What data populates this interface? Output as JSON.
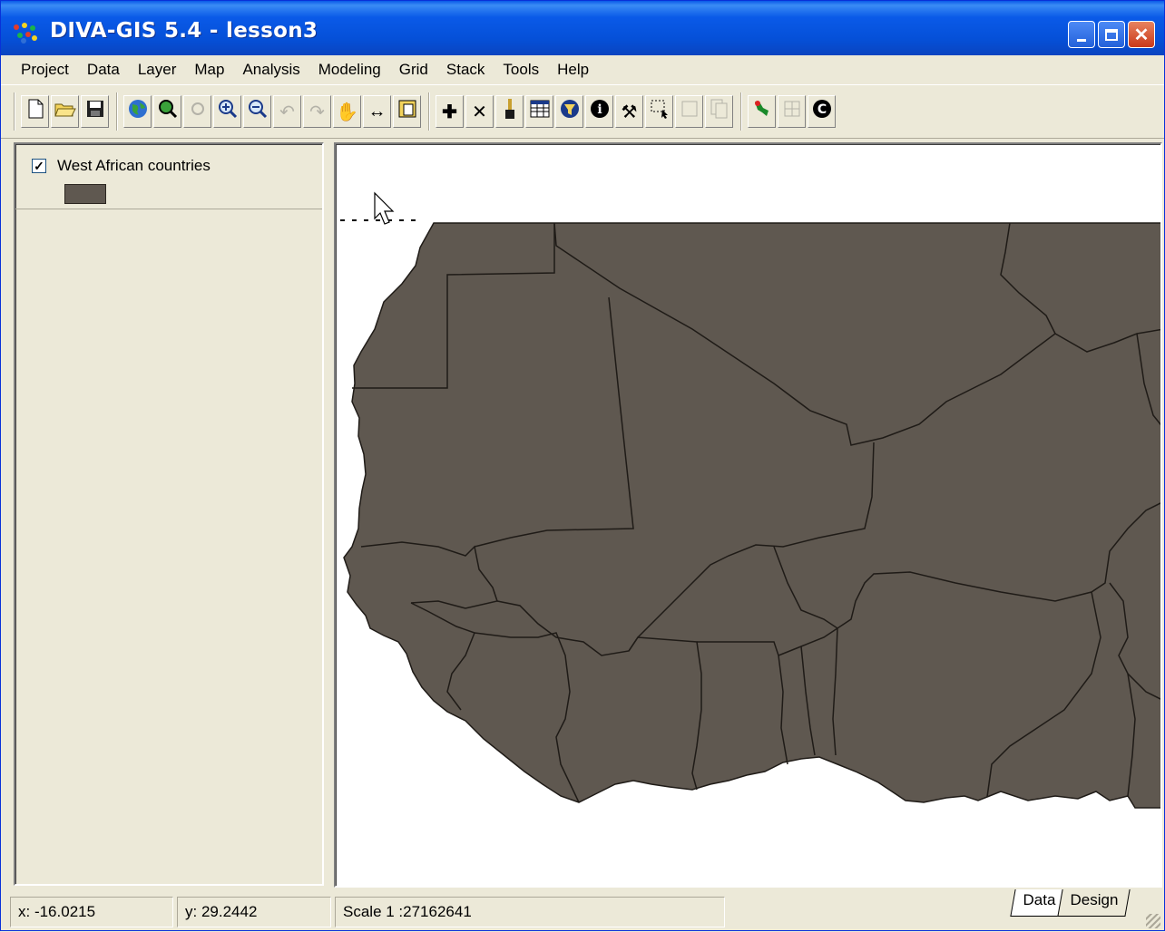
{
  "window": {
    "title": "DIVA-GIS 5.4 - lesson3",
    "colors": {
      "titlebar": "#0a5ae8",
      "chrome": "#ece9d8",
      "map_fill": "#5f5850",
      "map_bg": "#ffffff"
    }
  },
  "menu": [
    "Project",
    "Data",
    "Layer",
    "Map",
    "Analysis",
    "Modeling",
    "Grid",
    "Stack",
    "Tools",
    "Help"
  ],
  "toolbar": {
    "groups": [
      [
        {
          "icon": "new-file-icon"
        },
        {
          "icon": "open-folder-icon"
        },
        {
          "icon": "save-icon"
        }
      ],
      [
        {
          "icon": "full-extent-globe-icon"
        },
        {
          "icon": "zoom-to-layer-icon"
        },
        {
          "icon": "zoom-selected-icon",
          "disabled": true
        },
        {
          "icon": "zoom-in-icon"
        },
        {
          "icon": "zoom-out-icon"
        },
        {
          "icon": "previous-extent-icon",
          "disabled": true
        },
        {
          "icon": "next-extent-icon",
          "disabled": true
        },
        {
          "icon": "pan-hand-icon"
        },
        {
          "icon": "measure-icon"
        },
        {
          "icon": "copy-map-icon"
        }
      ],
      [
        {
          "icon": "add-layer-icon"
        },
        {
          "icon": "remove-layer-icon"
        },
        {
          "icon": "layer-properties-icon"
        },
        {
          "icon": "attribute-table-icon"
        },
        {
          "icon": "query-icon"
        },
        {
          "icon": "identify-icon"
        },
        {
          "icon": "tools-icon"
        },
        {
          "icon": "select-features-icon"
        },
        {
          "icon": "clear-selection-icon",
          "disabled": true
        },
        {
          "icon": "copy-selection-icon",
          "disabled": true
        }
      ],
      [
        {
          "icon": "map-tool-icon"
        },
        {
          "icon": "grid-icon",
          "disabled": true
        },
        {
          "icon": "copyright-icon"
        }
      ]
    ]
  },
  "legend": {
    "layers": [
      {
        "name": "West African countries",
        "checked": true,
        "fill": "#5f5850"
      }
    ]
  },
  "status": {
    "x": "x: -16.0215",
    "y": "y: 29.2442",
    "scale": "Scale 1 :27162641",
    "tabs": [
      "Data",
      "Design"
    ],
    "active_tab": "Data"
  }
}
